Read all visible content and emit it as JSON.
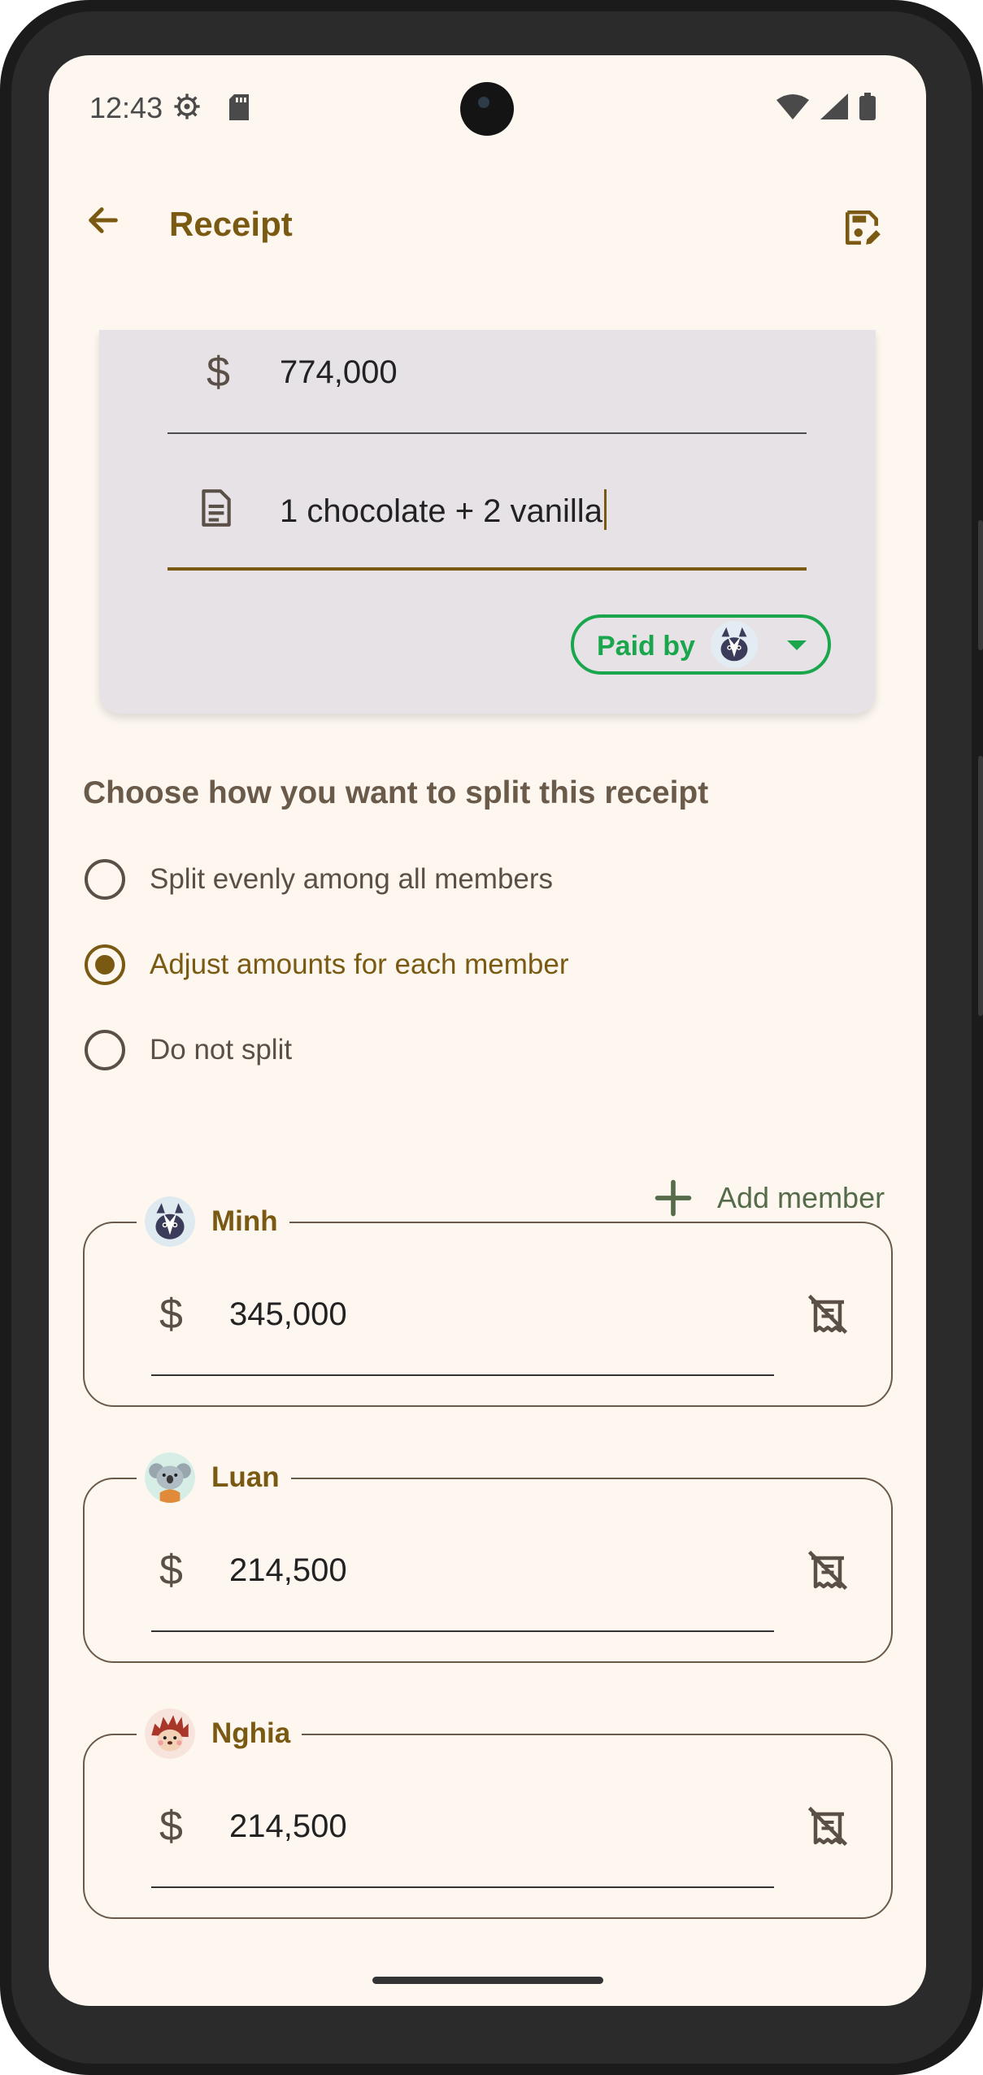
{
  "status_bar": {
    "time": "12:43"
  },
  "app_bar": {
    "title": "Receipt"
  },
  "receipt": {
    "currency_symbol": "$",
    "amount": "774,000",
    "note": "1 chocolate + 2 vanilla",
    "paid_by_label": "Paid by"
  },
  "split": {
    "heading": "Choose how you want to split this receipt",
    "options": [
      {
        "label": "Split evenly among all members",
        "selected": false
      },
      {
        "label": "Adjust amounts for each member",
        "selected": true
      },
      {
        "label": "Do not split",
        "selected": false
      }
    ],
    "add_member_label": "Add member"
  },
  "members": [
    {
      "name": "Minh",
      "currency_symbol": "$",
      "amount": "345,000",
      "avatar": "skunk-avatar"
    },
    {
      "name": "Luan",
      "currency_symbol": "$",
      "amount": "214,500",
      "avatar": "koala-avatar"
    },
    {
      "name": "Nghia",
      "currency_symbol": "$",
      "amount": "214,500",
      "avatar": "hedgehog-avatar"
    }
  ],
  "colors": {
    "accent": "#7a5a12",
    "paid_by_green": "#1aa64c",
    "background": "#fdf7f0",
    "card": "#e7e2e6"
  }
}
